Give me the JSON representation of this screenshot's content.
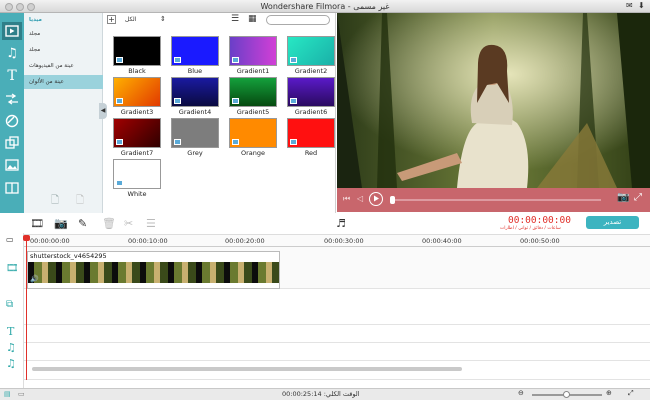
{
  "window": {
    "title": "Wondershare Filmora - غير مسمى"
  },
  "categories": {
    "header": "ميديا",
    "items": [
      "مجلد",
      "مجلد",
      "عينة من الفيديوهات",
      "عينة من الألوان"
    ],
    "selected_index": 3
  },
  "library": {
    "filter_label": "الكل",
    "search_placeholder": "",
    "swatches": [
      {
        "label": "Black",
        "color": "#000000"
      },
      {
        "label": "Blue",
        "color": "#1a1aff"
      },
      {
        "label": "Gradient1",
        "color": "linear-gradient(90deg,#6a3fc8,#d23fd6)"
      },
      {
        "label": "Gradient2",
        "color": "linear-gradient(135deg,#27e8c4,#1ab0a8)"
      },
      {
        "label": "Gradient3",
        "color": "linear-gradient(135deg,#ffb000,#e23a00)"
      },
      {
        "label": "Gradient4",
        "color": "linear-gradient(180deg,#1a1aa0,#0a0a40)"
      },
      {
        "label": "Gradient5",
        "color": "linear-gradient(180deg,#14a03c,#064a10)"
      },
      {
        "label": "Gradient6",
        "color": "linear-gradient(180deg,#5a1ac8,#2a0a60)"
      },
      {
        "label": "Gradient7",
        "color": "linear-gradient(135deg,#a00000,#300000)"
      },
      {
        "label": "Grey",
        "color": "#7d7d7d"
      },
      {
        "label": "Orange",
        "color": "#ff8a00"
      },
      {
        "label": "Red",
        "color": "#ff1010"
      },
      {
        "label": "White",
        "color": "#ffffff"
      }
    ]
  },
  "export": {
    "label": "تصدير",
    "color": "#3db4c0"
  },
  "timecode": {
    "value": "00:00:00:00",
    "subtitle": "ساعات / دقائق / ثواني / اطارات",
    "color": "#e0302a"
  },
  "ruler": {
    "ticks": [
      "00:00:00:00",
      "00:00:10:00",
      "00:00:20:00",
      "00:00:30:00",
      "00:00:40:00",
      "00:00:50:00"
    ]
  },
  "clip": {
    "name": "shutterstock_v4654295"
  },
  "status": {
    "total_time": "الوقت الكلي: 00:00:25:14"
  },
  "colors": {
    "accent": "#4aaeb8",
    "player_bar": "#c8666c",
    "playhead": "#e0302a"
  }
}
